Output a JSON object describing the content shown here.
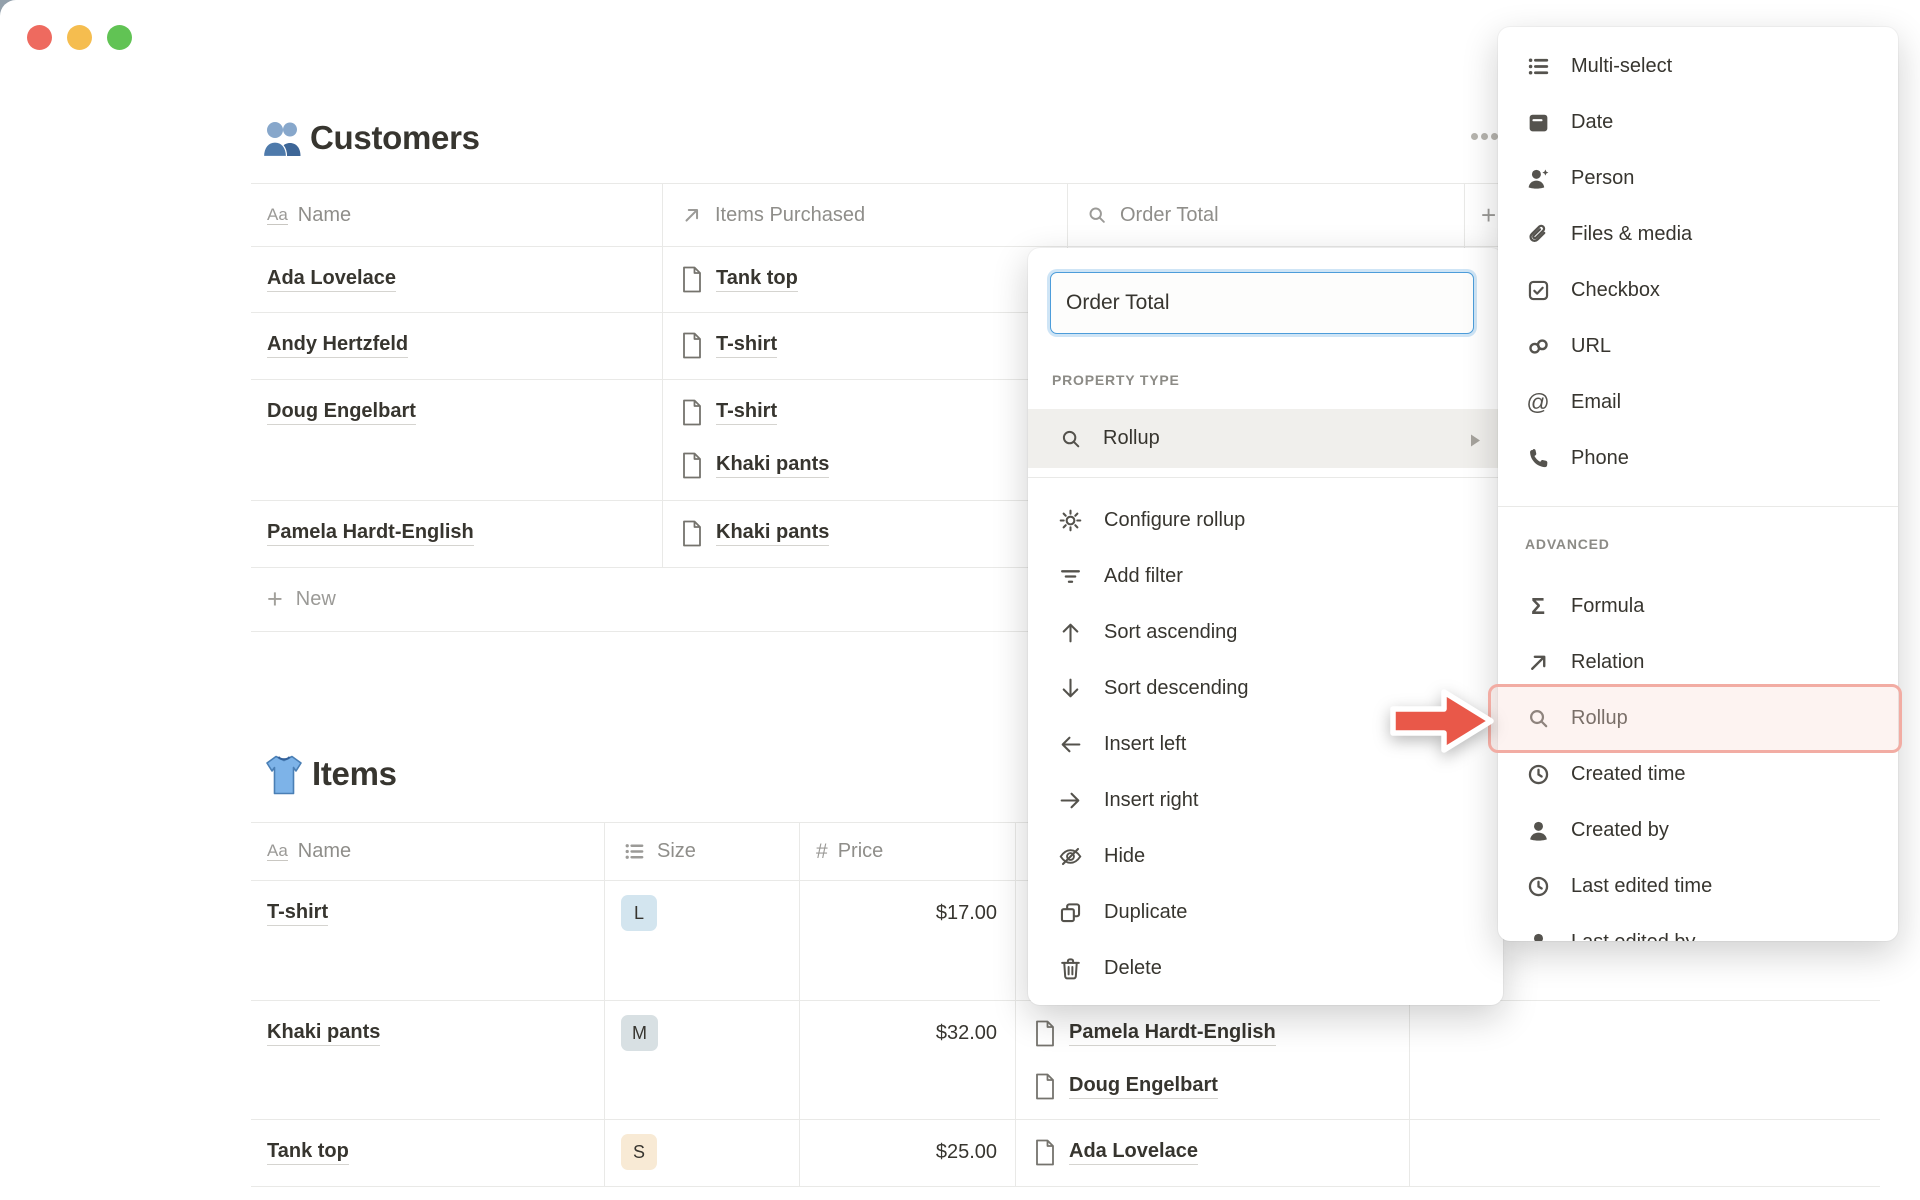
{
  "window": {
    "traffic_lights": [
      {
        "name": "close",
        "color": "#ee6a5f"
      },
      {
        "name": "minimize",
        "color": "#f5bd4f"
      },
      {
        "name": "zoom",
        "color": "#61c354"
      }
    ]
  },
  "customers": {
    "title": "Customers",
    "columns": [
      {
        "label": "Name"
      },
      {
        "label": "Items Purchased"
      },
      {
        "label": "Order Total"
      },
      {
        "label": "+"
      }
    ],
    "rows": [
      {
        "name": "Ada Lovelace",
        "items": [
          "Tank top"
        ]
      },
      {
        "name": "Andy Hertzfeld",
        "items": [
          "T-shirt"
        ]
      },
      {
        "name": "Doug Engelbart",
        "items": [
          "T-shirt",
          "Khaki pants"
        ]
      },
      {
        "name": "Pamela Hardt-English",
        "items": [
          "Khaki pants"
        ]
      }
    ],
    "new_row_label": "New"
  },
  "items": {
    "title": "Items",
    "columns": [
      {
        "label": "Name"
      },
      {
        "label": "Size"
      },
      {
        "label": "Price"
      }
    ],
    "rows": [
      {
        "name": "T-shirt",
        "size": "L",
        "size_color": "blue",
        "price": "$17.00",
        "purchased_by": []
      },
      {
        "name": "Khaki pants",
        "size": "M",
        "size_color": "gray",
        "price": "$32.00",
        "purchased_by": [
          "Pamela Hardt-English",
          "Doug Engelbart"
        ]
      },
      {
        "name": "Tank top",
        "size": "S",
        "size_color": "yellow",
        "price": "$25.00",
        "purchased_by": [
          "Ada Lovelace"
        ]
      }
    ]
  },
  "property_menu": {
    "name_input_value": "Order Total",
    "section_label": "PROPERTY TYPE",
    "selected_type": "Rollup",
    "actions": [
      "Configure rollup",
      "Add filter",
      "Sort ascending",
      "Sort descending",
      "Insert left",
      "Insert right",
      "Hide",
      "Duplicate",
      "Delete"
    ]
  },
  "type_menu": {
    "basic": [
      "Multi-select",
      "Date",
      "Person",
      "Files & media",
      "Checkbox",
      "URL",
      "Email",
      "Phone"
    ],
    "advanced_label": "ADVANCED",
    "advanced": [
      "Formula",
      "Relation",
      "Rollup",
      "Created time",
      "Created by",
      "Last edited time",
      "Last edited by"
    ],
    "highlighted_item": "Rollup"
  },
  "colors": {
    "text": "#37352f",
    "secondary_text": "#8f8e8a",
    "divider": "#e9e9e7",
    "tag_blue": "#d3e5ef",
    "tag_gray": "#d8e0e3",
    "tag_yellow": "#f8ead5",
    "focus_blue": "#4d9dda",
    "annotation_red": "#e95849",
    "annotation_pink_border": "#f2aca3",
    "selected_row_bg": "#f0efec"
  }
}
